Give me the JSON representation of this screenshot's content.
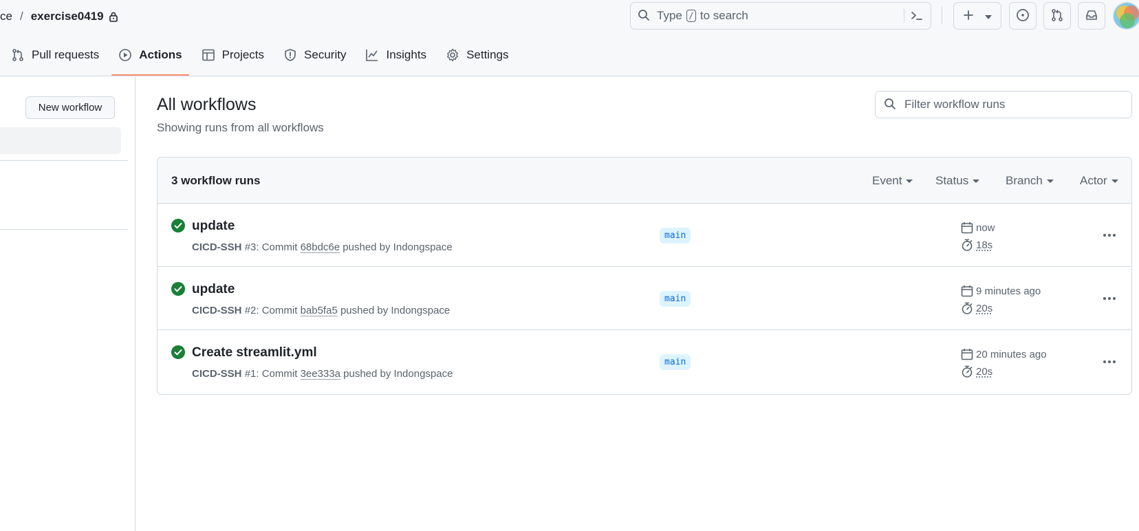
{
  "header": {
    "owner_partial": "ce",
    "separator": "/",
    "repo": "exercise0419",
    "search": {
      "before": "Type",
      "key": "/",
      "after": "to search"
    }
  },
  "tabs": [
    {
      "label": "Pull requests",
      "icon": "pull-request-icon",
      "active": false
    },
    {
      "label": "Actions",
      "icon": "play-icon",
      "active": true
    },
    {
      "label": "Projects",
      "icon": "table-icon",
      "active": false
    },
    {
      "label": "Security",
      "icon": "shield-icon",
      "active": false
    },
    {
      "label": "Insights",
      "icon": "graph-icon",
      "active": false
    },
    {
      "label": "Settings",
      "icon": "gear-icon",
      "active": false
    }
  ],
  "sidebar": {
    "new_workflow_label": "New workflow"
  },
  "main": {
    "title": "All workflows",
    "subtitle": "Showing runs from all workflows",
    "filter_placeholder": "Filter workflow runs",
    "runs_count": "3 workflow runs",
    "filters": {
      "event": "Event",
      "status": "Status",
      "branch": "Branch",
      "actor": "Actor"
    },
    "runs": [
      {
        "title": "update",
        "workflow": "CICD-SSH",
        "number": "#3",
        "commit_label": "Commit",
        "sha": "68bdc6e",
        "pushed_by": "pushed by Indongspace",
        "branch": "main",
        "when": "now",
        "duration": "18s",
        "status": "success"
      },
      {
        "title": "update",
        "workflow": "CICD-SSH",
        "number": "#2",
        "commit_label": "Commit",
        "sha": "bab5fa5",
        "pushed_by": "pushed by Indongspace",
        "branch": "main",
        "when": "9 minutes ago",
        "duration": "20s",
        "status": "success"
      },
      {
        "title": "Create streamlit.yml",
        "workflow": "CICD-SSH",
        "number": "#1",
        "commit_label": "Commit",
        "sha": "3ee333a",
        "pushed_by": "pushed by Indongspace",
        "branch": "main",
        "when": "20 minutes ago",
        "duration": "20s",
        "status": "success"
      }
    ]
  },
  "colors": {
    "success": "#1a7f37",
    "accent_underline": "#fd8c73",
    "branch_bg": "#ddf4ff",
    "branch_fg": "#0969da"
  }
}
